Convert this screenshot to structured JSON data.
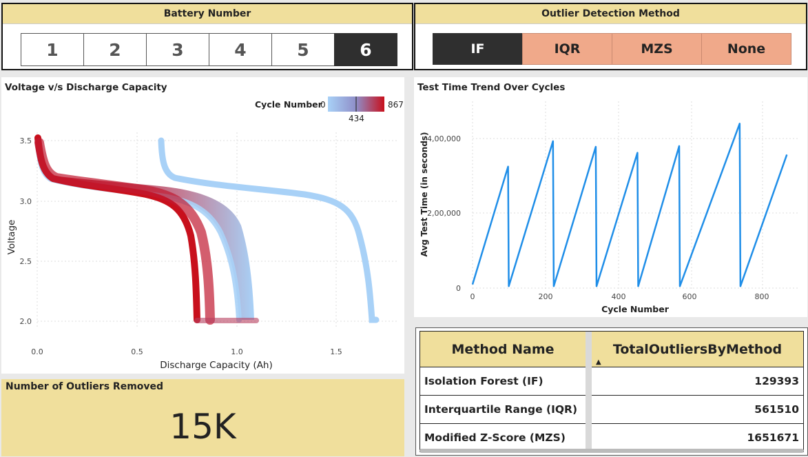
{
  "battery_slicer": {
    "title": "Battery Number",
    "options": [
      "1",
      "2",
      "3",
      "4",
      "5",
      "6"
    ],
    "selected": "6"
  },
  "method_slicer": {
    "title": "Outlier Detection Method",
    "options": [
      "IF",
      "IQR",
      "MZS",
      "None"
    ],
    "selected": "IF"
  },
  "voltage_chart": {
    "title": "Voltage v/s Discharge Capacity",
    "xlabel": "Discharge Capacity (Ah)",
    "ylabel": "Voltage",
    "xticks": [
      "0.0",
      "0.5",
      "1.0",
      "1.5"
    ],
    "yticks": [
      "3.5",
      "3.0",
      "2.5",
      "2.0"
    ],
    "legend": {
      "label": "Cycle Number",
      "min": "0",
      "mid": "434",
      "max": "867"
    },
    "colors": {
      "low": "#a8d1f7",
      "high": "#c8101c"
    }
  },
  "chart_data": {
    "type": "line",
    "title": "Test Time Trend Over Cycles",
    "xlabel": "Cycle Number",
    "ylabel": "Avg Test Time (in seconds)",
    "xticks": [
      "0",
      "200",
      "400",
      "600",
      "800"
    ],
    "yticks": [
      "0",
      "2,00,000",
      "4,00,000"
    ],
    "xlim": [
      0,
      880
    ],
    "ylim": [
      0,
      450000
    ],
    "grid": true,
    "line_color": "#1f8ee8",
    "x": [
      0,
      98,
      100,
      222,
      224,
      340,
      342,
      455,
      457,
      570,
      572,
      737,
      739,
      867
    ],
    "y": [
      10000,
      325000,
      5000,
      393000,
      5000,
      378000,
      5000,
      362000,
      5000,
      380000,
      5000,
      440000,
      5000,
      357000
    ]
  },
  "kpi": {
    "title": "Number of Outliers Removed",
    "value": "15K"
  },
  "table": {
    "headers": [
      "Method Name",
      "TotalOutliersByMethod"
    ],
    "rows": [
      {
        "name": "Isolation Forest (IF)",
        "value": "129393"
      },
      {
        "name": "Interquartile Range (IQR)",
        "value": "561510"
      },
      {
        "name": "Modified Z-Score (MZS)",
        "value": "1651671"
      }
    ]
  }
}
